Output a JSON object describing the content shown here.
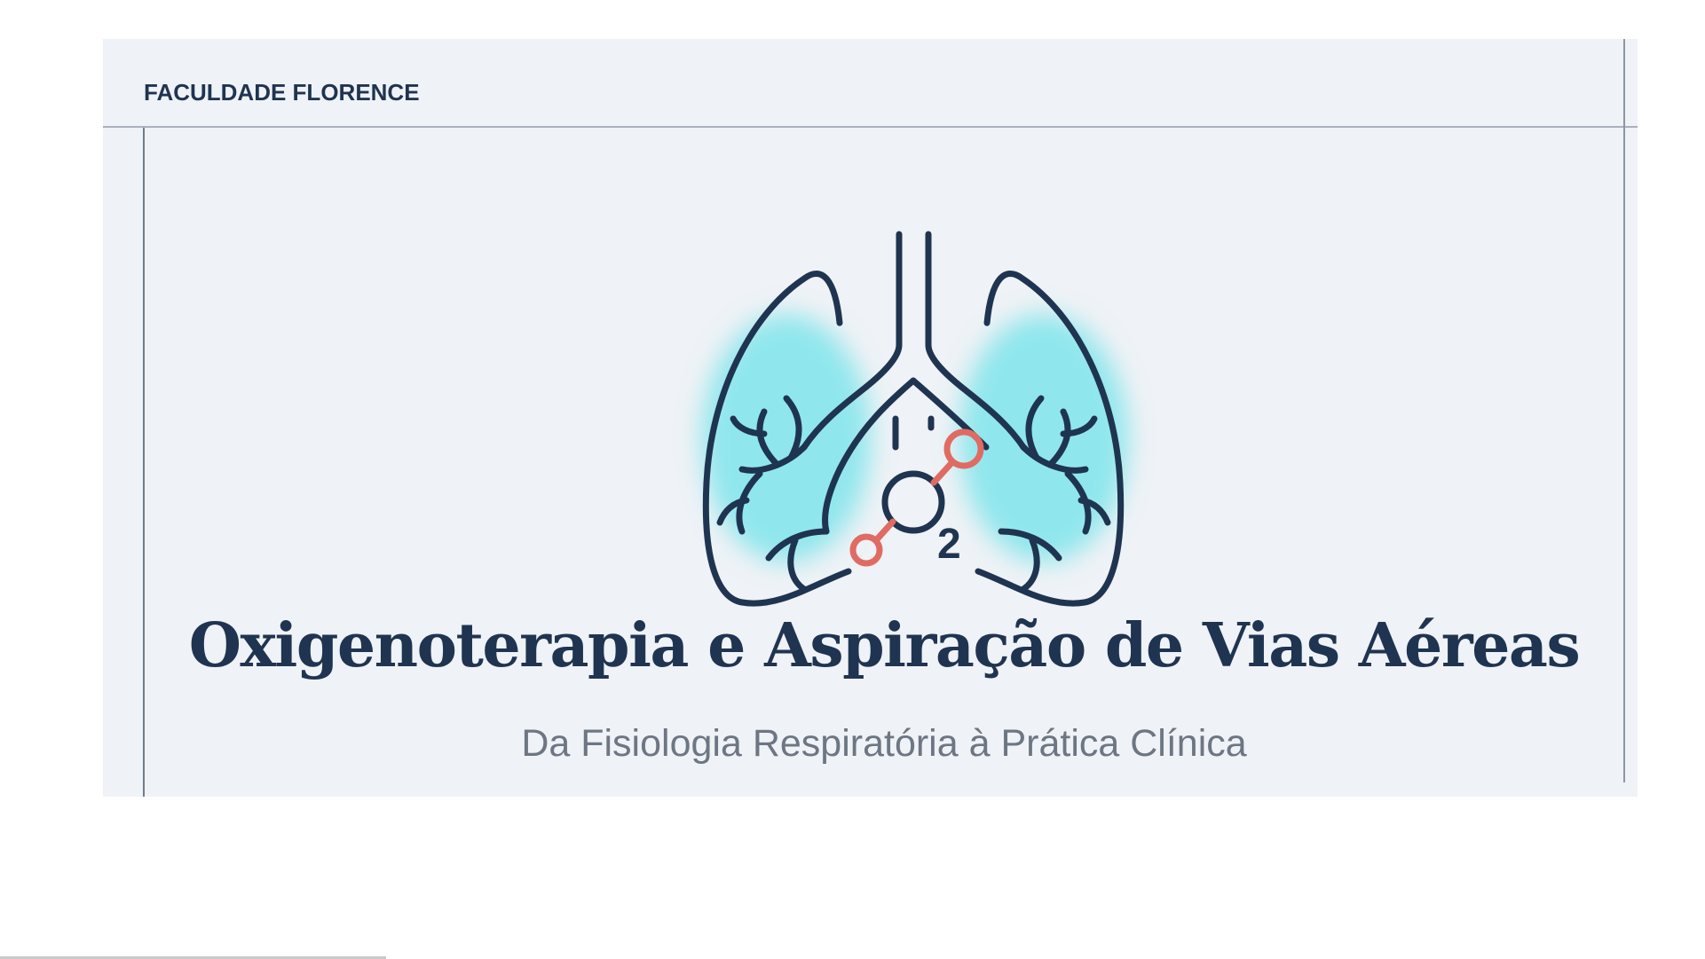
{
  "slide": {
    "brand": "FACULDADE FLORENCE",
    "title": "Oxigenoterapia e Aspiração de Vias Aéreas",
    "subtitle": "Da Fisiologia Respiratória à Prática Clínica"
  },
  "logo": {
    "icon": "lungs-oxygen-icon",
    "subscript": "2",
    "colors": {
      "outline": "#1f3450",
      "glow": "#5fe0e6",
      "accent": "#e06b63"
    }
  }
}
